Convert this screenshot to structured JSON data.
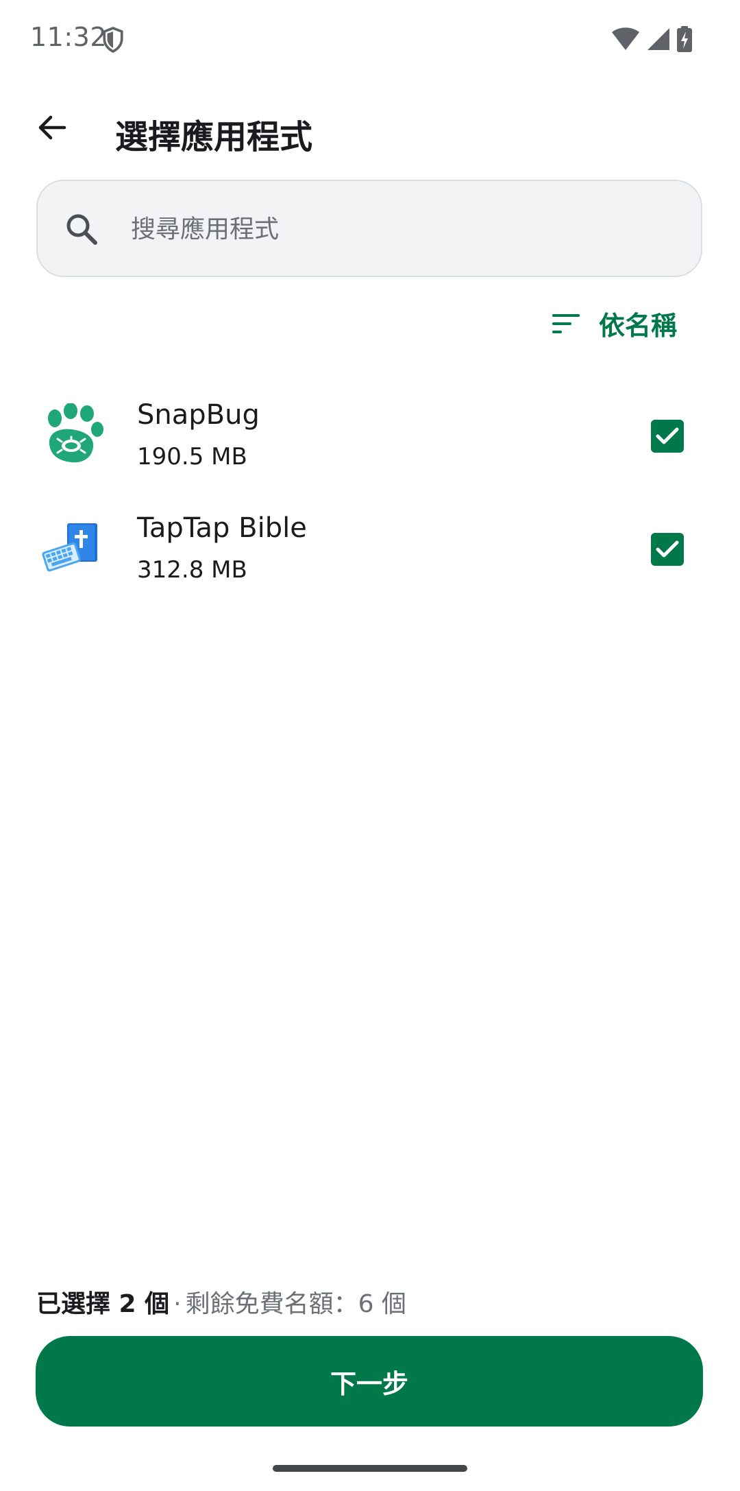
{
  "status_bar": {
    "time": "11:32",
    "icons": [
      "shield-icon",
      "wifi-icon",
      "cell-signal-icon",
      "battery-charging-icon"
    ]
  },
  "header": {
    "back_icon": "arrow-left-icon",
    "title": "選擇應用程式"
  },
  "search": {
    "placeholder": "搜尋應用程式",
    "value": "",
    "icon": "search-icon"
  },
  "sort": {
    "icon": "sort-icon",
    "label": "依名稱"
  },
  "apps": [
    {
      "name": "SnapBug",
      "size": "190.5 MB",
      "icon": "paw-bug-icon",
      "checked": true
    },
    {
      "name": "TapTap Bible",
      "size": "312.8 MB",
      "icon": "keyboard-bible-icon",
      "checked": true
    }
  ],
  "footer": {
    "selected_text": "已選擇 2 個",
    "separator": "·",
    "quota_text": "剩餘免費名額：6 個",
    "next_label": "下一步"
  },
  "colors": {
    "accent": "#00784a",
    "text": "#1b1b1f",
    "muted": "#6b6f76",
    "search_bg": "#f1f3f5"
  }
}
